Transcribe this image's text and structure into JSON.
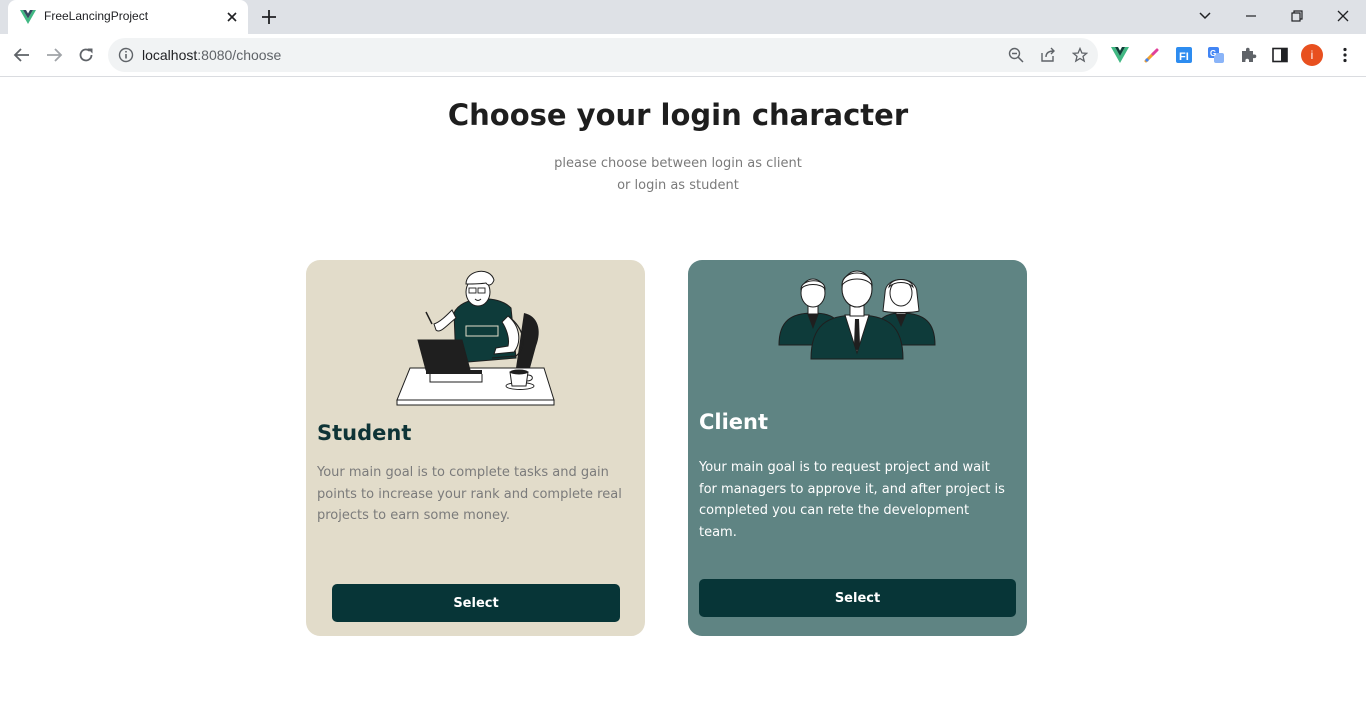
{
  "browser": {
    "tab_title": "FreeLancingProject",
    "url_host": "localhost",
    "url_path": ":8080/choose",
    "profile_initial": "i",
    "colors": {
      "tabstrip": "#dee1e6",
      "omnibox": "#f1f3f4",
      "profile": "#e8501f"
    },
    "icons": [
      "vue-favicon-icon",
      "close-icon",
      "plus-icon",
      "chevron-down-icon",
      "minimize-icon",
      "restore-icon",
      "close-window-icon",
      "back-arrow-icon",
      "forward-arrow-icon",
      "reload-icon",
      "info-icon",
      "zoom-out-icon",
      "share-icon",
      "star-icon",
      "vue-devtools-icon",
      "color-picker-icon",
      "extension-f-icon",
      "google-translate-icon",
      "extensions-puzzle-icon",
      "side-panel-icon",
      "more-vert-icon"
    ]
  },
  "page": {
    "title": "Choose your login character",
    "subtitle_line1": "please choose between login as client",
    "subtitle_line2": "or login as student"
  },
  "cards": {
    "student": {
      "heading": "Student",
      "description": "Your main goal is to complete tasks and gain points to increase your rank and complete real projects to earn some money.",
      "button_label": "Select",
      "background": "#e2dcca",
      "illustration": "student-laptop-illustration"
    },
    "client": {
      "heading": "Client",
      "description": "Your main goal is to request project and wait for managers to approve it, and after project is completed you can rete the development team.",
      "button_label": "Select",
      "background": "#5f8483",
      "illustration": "client-team-illustration"
    }
  },
  "colors": {
    "button": "#073537",
    "heading_dark": "#0e3436"
  }
}
